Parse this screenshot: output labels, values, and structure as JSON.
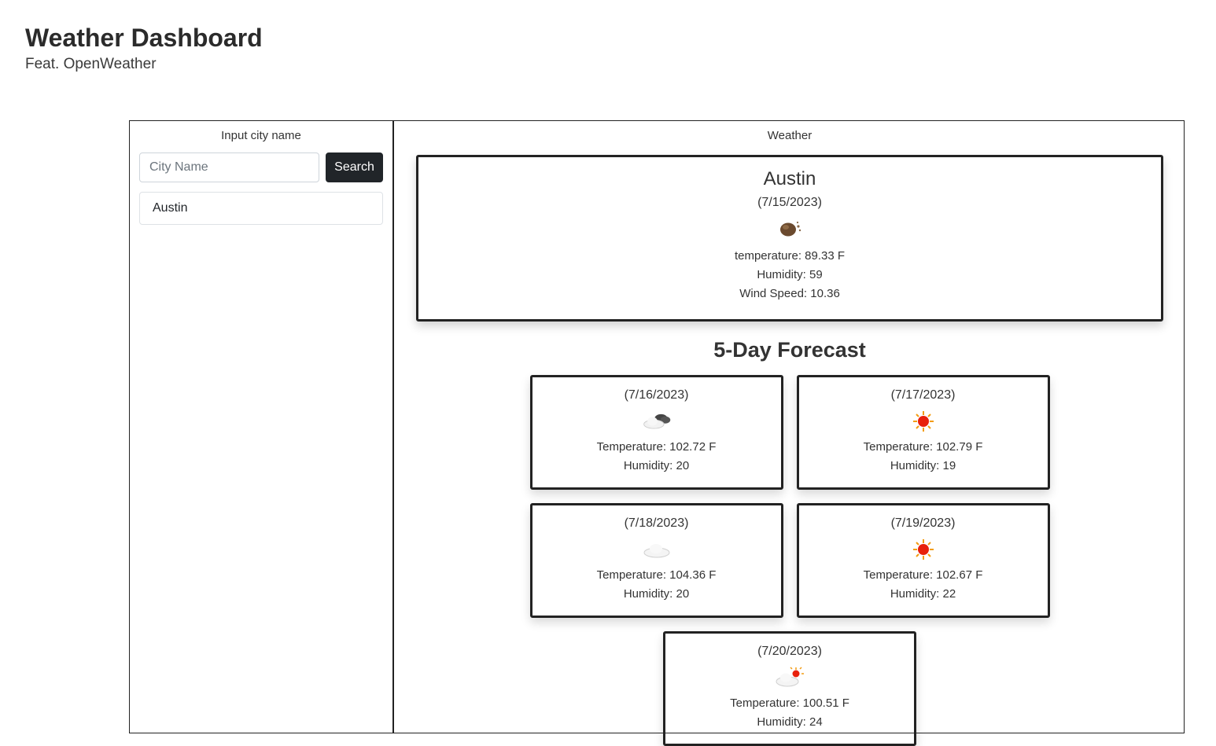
{
  "header": {
    "title": "Weather Dashboard",
    "subtitle": "Feat. OpenWeather"
  },
  "sidebar": {
    "title": "Input city name",
    "search_placeholder": "City Name",
    "search_value": "",
    "search_button": "Search",
    "history": [
      "Austin"
    ]
  },
  "main": {
    "title": "Weather",
    "current": {
      "city": "Austin",
      "date": "(7/15/2023)",
      "icon": "dust-icon",
      "temperature": "temperature: 89.33 F",
      "humidity": "Humidity: 59",
      "wind": "Wind Speed: 10.36"
    },
    "forecast_heading": "5-Day Forecast",
    "forecast": [
      {
        "date": "(7/16/2023)",
        "icon": "broken-clouds-icon",
        "temperature": "Temperature: 102.72 F",
        "humidity": "Humidity: 20"
      },
      {
        "date": "(7/17/2023)",
        "icon": "clear-sky-icon",
        "temperature": "Temperature: 102.79 F",
        "humidity": "Humidity: 19"
      },
      {
        "date": "(7/18/2023)",
        "icon": "cloud-icon",
        "temperature": "Temperature: 104.36 F",
        "humidity": "Humidity: 20"
      },
      {
        "date": "(7/19/2023)",
        "icon": "clear-sky-icon",
        "temperature": "Temperature: 102.67 F",
        "humidity": "Humidity: 22"
      },
      {
        "date": "(7/20/2023)",
        "icon": "few-clouds-icon",
        "temperature": "Temperature: 100.51 F",
        "humidity": "Humidity: 24"
      }
    ]
  }
}
